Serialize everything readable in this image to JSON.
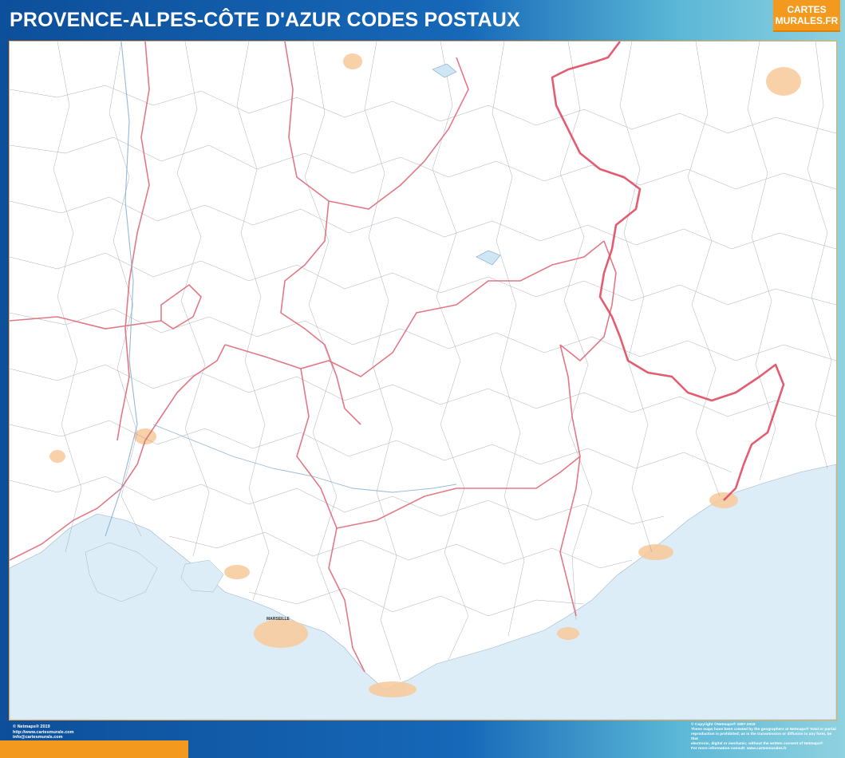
{
  "header": {
    "title": "PROVENCE-ALPES-CÔTE D'AZUR CODES POSTAUX"
  },
  "brand": {
    "line1": "CARTES",
    "line2": "MURALES.FR"
  },
  "map": {
    "sea_color": "#dcedf7",
    "land_color": "#ffffff",
    "region_border_color": "#e06a78",
    "commune_border_color": "#8a94a6",
    "urban_color": "#f8c99a",
    "cities": {
      "marseille": "MARSEILLE"
    }
  },
  "footer": {
    "left": [
      "© Netmaps® 2019",
      "http://www.cartesmurale.com",
      "info@cartesmurals.com"
    ],
    "right": [
      "© Copyright ©Netmaps® 1997-2019",
      "These maps have been created by the geographers at Netmaps® Total or partial",
      "reproduction is prohibited; as is the transmission or diffusion in any form, be that",
      "electronic, digital or mechanic; without the written consent of Netmaps®",
      "For more information consult: www.cartesmurales.fr"
    ]
  },
  "colors": {
    "frame_blue": "#1668b8",
    "accent_orange": "#f39a1e"
  }
}
